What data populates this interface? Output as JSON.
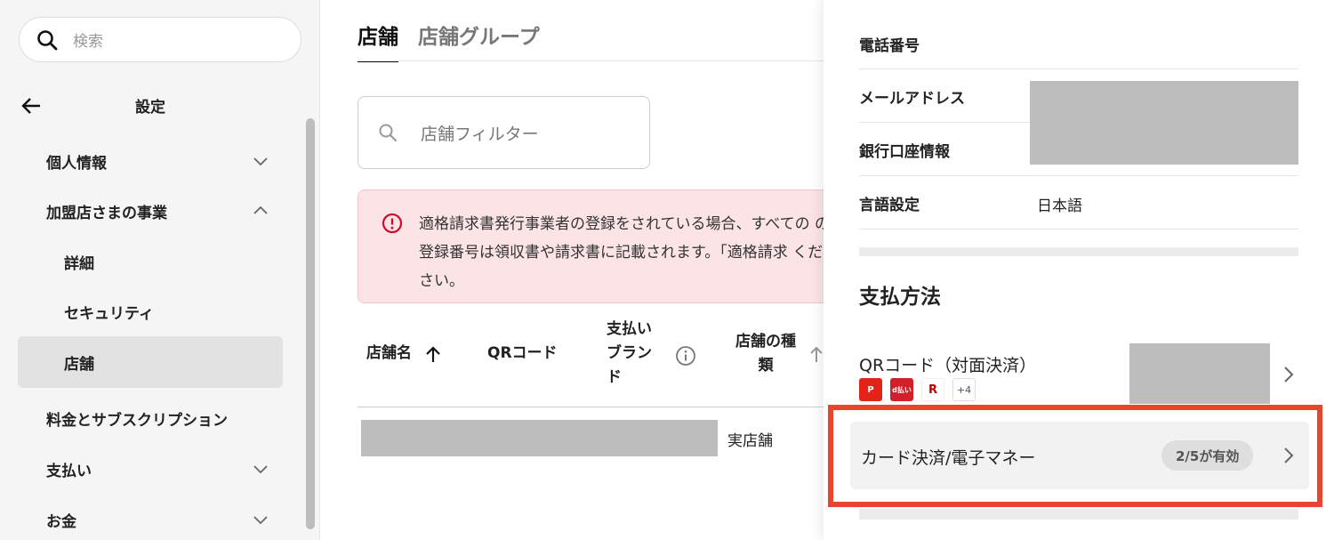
{
  "sidebar": {
    "search_placeholder": "検索",
    "title": "設定",
    "items": [
      {
        "label": "個人情報"
      },
      {
        "label": "加盟店さまの事業"
      },
      {
        "label": "詳細"
      },
      {
        "label": "セキュリティ"
      },
      {
        "label": "店舗"
      },
      {
        "label": "料金とサブスクリプション"
      },
      {
        "label": "支払い"
      },
      {
        "label": "お金"
      }
    ]
  },
  "main": {
    "tabs": [
      {
        "label": "店舗"
      },
      {
        "label": "店舗グループ"
      }
    ],
    "filter_placeholder": "店舗フィルター",
    "alert_text": "適格請求書発行事業者の登録をされている場合、すべての の登録番号は領収書や請求書に記載されます。「適格請求 ください。",
    "table": {
      "headers": [
        "店舗名",
        "QRコード",
        "支払い ブランド",
        "店舗の種類"
      ],
      "rows": [
        {
          "type": "実店舗"
        }
      ]
    }
  },
  "panel": {
    "fields": [
      {
        "label": "電話番号",
        "value": ""
      },
      {
        "label": "メールアドレス",
        "value": ""
      },
      {
        "label": "銀行口座情報",
        "value": ""
      },
      {
        "label": "言語設定",
        "value": "日本語"
      }
    ],
    "section_title": "支払方法",
    "payment_methods": {
      "qr_label": "QRコード（対面決済）",
      "qr_more": "+4",
      "card_label": "カード決済/電子マネー",
      "card_status": "2/5が有効"
    }
  }
}
